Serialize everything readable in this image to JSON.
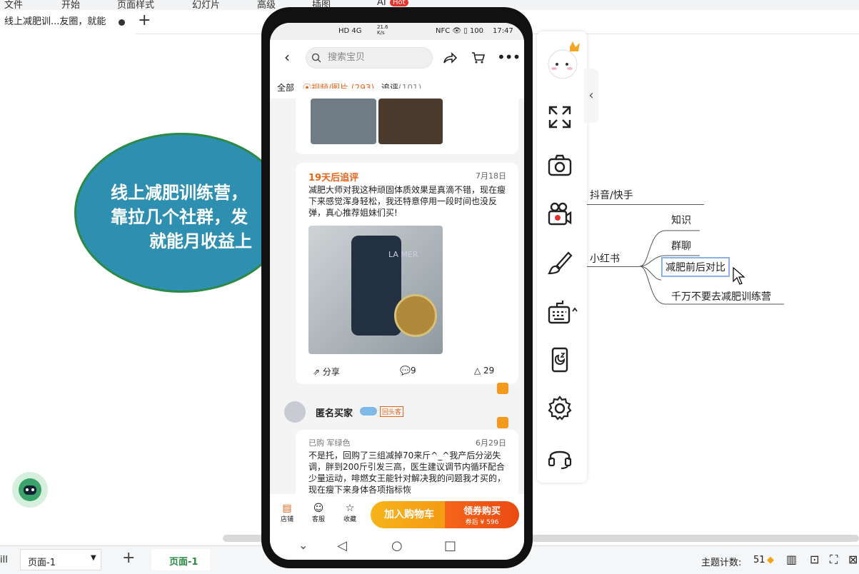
{
  "menu": [
    "文件",
    "开始",
    "页面样式",
    "幻灯片",
    "高级",
    "插图",
    "AI"
  ],
  "menu_hot_badge": "Hot",
  "doc_tab": {
    "title": "线上减肥训...友圈，就能"
  },
  "mindmap": {
    "central_lines": [
      "线上减肥训练营，",
      "靠拉几个社群，发",
      "就能月收益上"
    ],
    "branch_douyin": "抖音/快手",
    "branch_xhs": "小红书",
    "xhs_children": [
      "知识",
      "群聊",
      "减肥前后对比",
      "千万不要去减肥训练营"
    ]
  },
  "status": {
    "left_stub": "ill",
    "page_select": "页面-1",
    "page_tab": "页面-1",
    "topic_count_label": "主题计数:",
    "topic_count": "51"
  },
  "phone": {
    "statusbar": {
      "left": "HD 4G",
      "speed": "21.6 K/s",
      "right_icons": "NFC 👁 ▯ 100",
      "time": "17:47"
    },
    "search_placeholder": "搜索宝贝",
    "filters": {
      "all": "全部",
      "media": "视频/图片 (293)",
      "followup": "追评",
      "followup_count": "(101)"
    },
    "review1": {
      "tag": "19天后追评",
      "date": "7月18日",
      "text": "减肥大师对我这种顽固体质效果是真滴不错，现在瘦下来感觉浑身轻松，我还特意停用一段时间也没反弹，真心推荐姐妹们买!",
      "product_label": "LA MER",
      "share": "分享",
      "comments": "9",
      "likes": "29"
    },
    "review2": {
      "user": "匿名买家",
      "user_badge": "回头客",
      "variant": "已购 军绿色",
      "date": "6月29日",
      "text": "不是托，回购了三组减掉70来斤^_^我产后分泌失调，胖到200斤引发三高，医生建议调节内循环配合少量运动，啡燃女王能针对解决我的问题我才买的，现在瘦下来身体各项指标恢"
    },
    "side_badge_text": "问",
    "bottom": {
      "shop": "店铺",
      "service": "客服",
      "favorite": "收藏",
      "add_cart": "加入购物车",
      "buy": "领券购买",
      "buy_sub": "券后 ¥ 596"
    }
  },
  "colors": {
    "node_fill": "#2e8fb0",
    "node_border": "#2b8a44",
    "buy_orange": "#ea4a12",
    "cart_yellow": "#f6b419",
    "review_tag": "#e5651c"
  }
}
